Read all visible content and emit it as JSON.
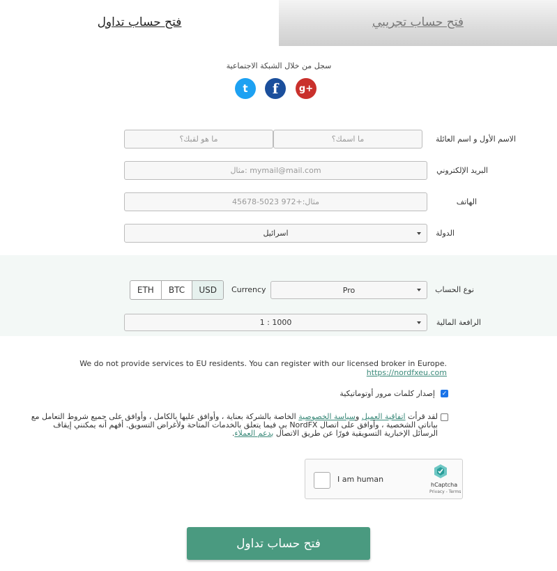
{
  "tabs": {
    "real_label": "فتح حساب تداول",
    "demo_label": "فتح حساب تجريبي"
  },
  "social": {
    "title": "سجل من خلال الشبكة الاجتماعية",
    "twitter_glyph": "t",
    "facebook_glyph": "f",
    "google_glyph": "g+"
  },
  "form": {
    "name_label": "الاسم الأول و اسم العائلة",
    "first_name_placeholder": "ما اسمك؟",
    "last_name_placeholder": "ما هو لقبك؟",
    "email_label": "البريد الإلكتروني",
    "email_placeholder": "مثال: mymail@mail.com",
    "phone_label": "الهاتف",
    "phone_placeholder": "مثال:+972 5023-45678",
    "country_label": "الدولة",
    "country_value": "اسرائيل",
    "account_type_label": "نوع الحساب",
    "account_type_value": "Pro",
    "currency_label": "Currency",
    "currencies": [
      "ETH",
      "BTC",
      "USD"
    ],
    "selected_currency": "USD",
    "leverage_label": "الرافعة المالية",
    "leverage_value": "1 : 1000"
  },
  "eu_notice": {
    "text": "We do not provide services to EU residents. You can register with our licensed broker in Europe",
    "link": "https://nordfxeu.com",
    "end": "."
  },
  "auto_password": {
    "label": "إصدار كلمات مرور أوتوماتيكية",
    "checked": true
  },
  "terms": {
    "checked": false,
    "prefix": "لقد قرأت ",
    "link1": "اتفاقية العميل",
    "and": " و",
    "link2": "سياسة الخصوصية",
    "middle": " الخاصة بالشركة بعناية ، وأوافق عليها بالكامل ، وأوافق على جميع شروط التعامل مع بياناتي الشخصية ، وأوافق على اتصال NordFX بي فيما يتعلق بالخدمات المتاحة ولأغراض التسويق. أفهم أنه يمكنني إيقاف الرسائل الإخبارية التسويقية فورًا عن طريق الاتصال ",
    "link3": "بدعم العملاء",
    "end": "."
  },
  "captcha": {
    "label": "I am human",
    "brand": "hCaptcha",
    "links": "Privacy - Terms"
  },
  "submit_label": "فتح حساب تداول",
  "colors": {
    "accent": "#4a9a80",
    "link": "#3b8a7a",
    "band": "#f3f8f6"
  }
}
